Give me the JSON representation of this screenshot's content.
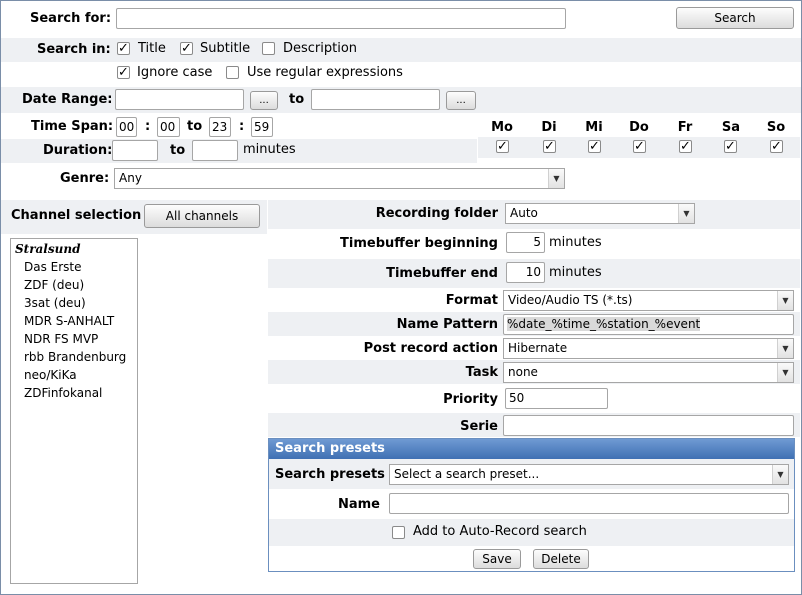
{
  "search": {
    "label": "Search for:",
    "value": "",
    "button": "Search"
  },
  "search_in": {
    "label": "Search in:",
    "title": {
      "label": "Title",
      "checked": true
    },
    "subtitle": {
      "label": "Subtitle",
      "checked": true
    },
    "description": {
      "label": "Description",
      "checked": false
    },
    "ignore_case": {
      "label": "Ignore case",
      "checked": true
    },
    "regex": {
      "label": "Use regular expressions",
      "checked": false
    }
  },
  "date_range": {
    "label": "Date Range:",
    "from": "",
    "to_label": "to",
    "to": "",
    "picker": "..."
  },
  "time_span": {
    "label": "Time Span:",
    "from_h": "00",
    "from_m": "00",
    "to_label": "to",
    "to_h": "23",
    "to_m": "59",
    "sep": ":"
  },
  "duration": {
    "label": "Duration:",
    "from": "",
    "to_label": "to",
    "to": "",
    "unit": "minutes"
  },
  "days": [
    {
      "label": "Mo",
      "checked": true
    },
    {
      "label": "Di",
      "checked": true
    },
    {
      "label": "Mi",
      "checked": true
    },
    {
      "label": "Do",
      "checked": true
    },
    {
      "label": "Fr",
      "checked": true
    },
    {
      "label": "Sa",
      "checked": true
    },
    {
      "label": "So",
      "checked": true
    }
  ],
  "genre": {
    "label": "Genre:",
    "value": "Any"
  },
  "channels": {
    "label": "Channel selection",
    "button": "All channels",
    "group": "Stralsund",
    "items": [
      "Das Erste",
      "ZDF (deu)",
      "3sat (deu)",
      "MDR S-ANHALT",
      "NDR FS MVP",
      "rbb Brandenburg",
      "neo/KiKa",
      "ZDFinfokanal"
    ]
  },
  "recording": {
    "folder_label": "Recording folder",
    "folder_value": "Auto",
    "tb_begin_label": "Timebuffer beginning",
    "tb_begin": "5",
    "tb_end_label": "Timebuffer end",
    "tb_end": "10",
    "minutes": "minutes",
    "format_label": "Format",
    "format_value": "Video/Audio TS (*.ts)",
    "name_pattern_label": "Name Pattern",
    "name_pattern": "%date_%time_%station_%event",
    "post_label": "Post record action",
    "post_value": "Hibernate",
    "task_label": "Task",
    "task_value": "none",
    "priority_label": "Priority",
    "priority": "50",
    "serie_label": "Serie",
    "serie": ""
  },
  "presets": {
    "header": "Search presets",
    "select_label": "Search presets",
    "select_value": "Select a search preset...",
    "name_label": "Name",
    "name_value": "",
    "auto_record": {
      "label": "Add to Auto-Record search",
      "checked": false
    },
    "save": "Save",
    "delete": "Delete"
  }
}
